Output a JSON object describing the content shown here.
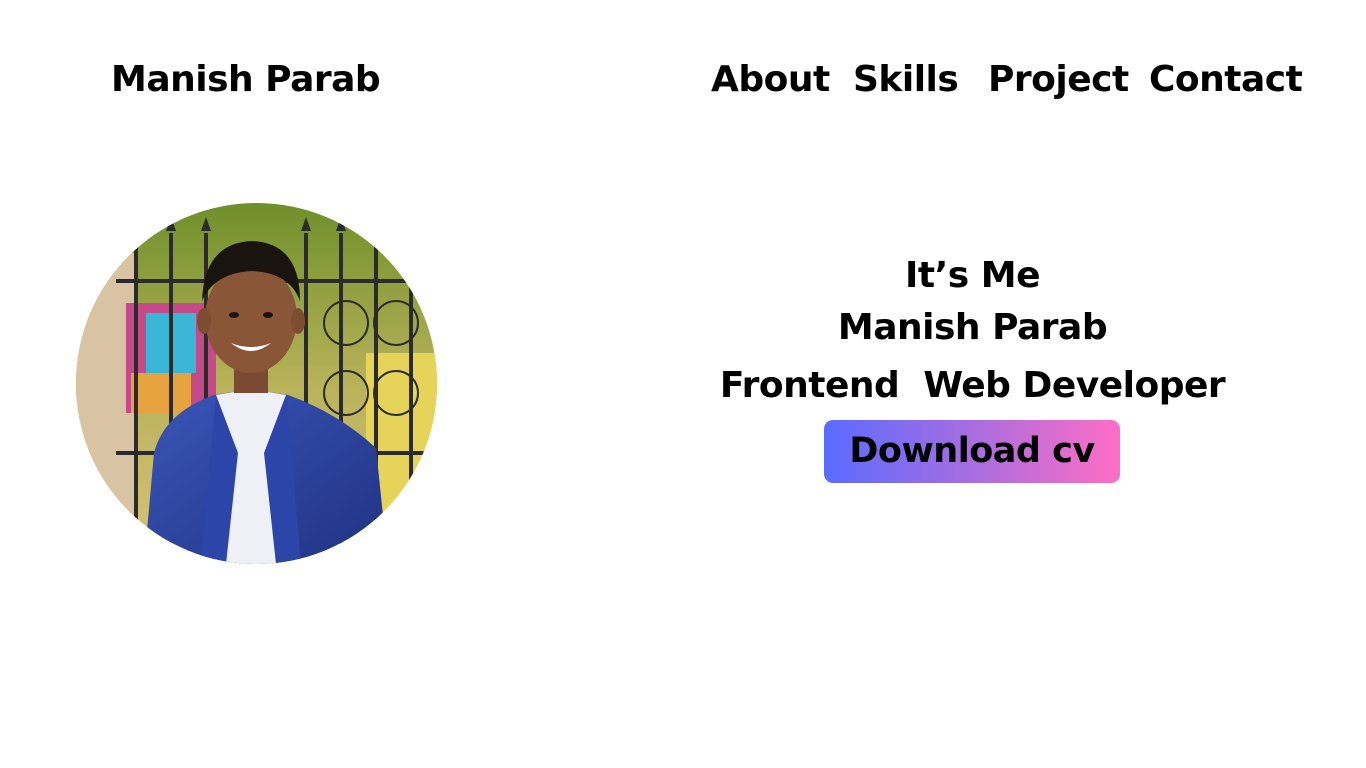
{
  "header": {
    "brand": "Manish Parab",
    "nav": [
      {
        "label": "About"
      },
      {
        "label": "Skills"
      },
      {
        "label": "Project"
      },
      {
        "label": "Contact"
      }
    ]
  },
  "hero": {
    "greeting": "It’s Me",
    "name": "Manish Parab",
    "role": "Frontend  Web Developer",
    "button_label": "Download cv"
  },
  "colors": {
    "background": "#ffffff",
    "text": "#000000",
    "button_gradient_start": "#5a6bff",
    "button_gradient_end": "#ff6ec4"
  }
}
